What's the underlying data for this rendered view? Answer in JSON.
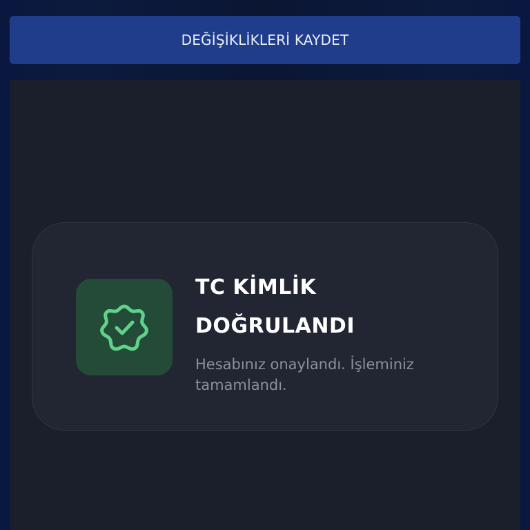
{
  "toolbar": {
    "save_label": "DEĞİŞİKLİKLERİ KAYDET"
  },
  "verification_card": {
    "icon": "verified-badge-icon",
    "title": "TC KİMLİK DOĞRULANDI",
    "subtitle": "Hesabınız onaylandı. İşleminiz tamamlandı."
  },
  "colors": {
    "accent_button": "#1f3d8a",
    "panel_background": "#1b1f2b",
    "card_background": "#222633",
    "icon_tile": "#244a38",
    "success_green": "#5fd38a"
  }
}
